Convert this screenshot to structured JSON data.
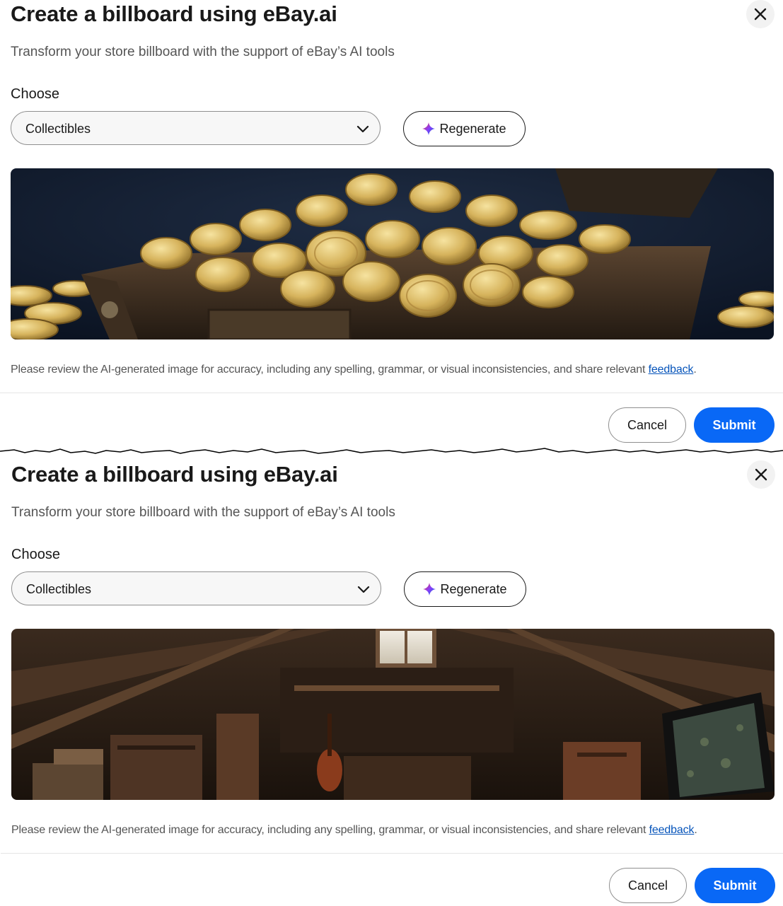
{
  "screens": [
    {
      "title": "Create a billboard using eBay.ai",
      "subtitle": "Transform your store billboard with the support of eBay’s AI tools",
      "choose_label": "Choose",
      "category_select": {
        "value": "Collectibles"
      },
      "regenerate_label": "Regenerate",
      "disclaimer": "Please review the AI-generated image for accuracy, including any spelling, grammar, or visual inconsistencies, and share relevant ",
      "feedback_link": "feedback",
      "cancel_label": "Cancel",
      "submit_label": "Submit"
    },
    {
      "title": "Create a billboard using eBay.ai",
      "subtitle": "Transform your store billboard with the support of eBay’s AI tools",
      "choose_label": "Choose",
      "category_select": {
        "value": "Collectibles"
      },
      "regenerate_label": "Regenerate",
      "disclaimer": "Please review the AI-generated image for accuracy, including any spelling, grammar, or visual inconsistencies, and share relevant ",
      "feedback_link": "feedback",
      "cancel_label": "Cancel",
      "submit_label": "Submit"
    }
  ],
  "icons": {
    "close": "close-icon",
    "chevron": "chevron-down-icon",
    "sparkle": "sparkle-icon"
  },
  "colors": {
    "primary": "#0968f6",
    "link": "#0654ba",
    "text": "#191919",
    "muted": "#555555"
  }
}
